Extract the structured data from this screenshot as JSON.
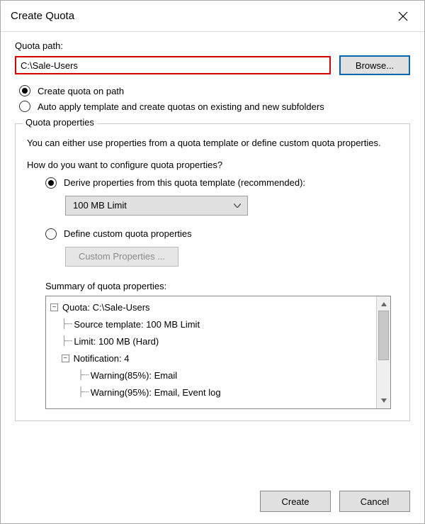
{
  "title": "Create Quota",
  "path": {
    "label": "Quota path:",
    "value": "C:\\Sale-Users",
    "browse": "Browse..."
  },
  "create_mode": {
    "path_label": "Create quota on path",
    "auto_label": "Auto apply template and create quotas on existing and new subfolders"
  },
  "properties": {
    "legend": "Quota properties",
    "intro": "You can either use properties from a quota template or define custom quota properties.",
    "prompt": "How do you want to configure quota properties?",
    "derive_label": "Derive properties from this quota template (recommended):",
    "template_selected": "100 MB Limit",
    "define_custom_label": "Define custom quota properties",
    "custom_btn": "Custom Properties ...",
    "summary_label": "Summary of quota properties:",
    "summary_tree": {
      "root": "Quota: C:\\Sale-Users",
      "lines": [
        "Source template: 100 MB Limit",
        "Limit: 100 MB (Hard)"
      ],
      "notif_label": "Notification: 4",
      "notif_lines": [
        "Warning(85%): Email",
        "Warning(95%): Email, Event log"
      ]
    }
  },
  "footer": {
    "create": "Create",
    "cancel": "Cancel"
  }
}
